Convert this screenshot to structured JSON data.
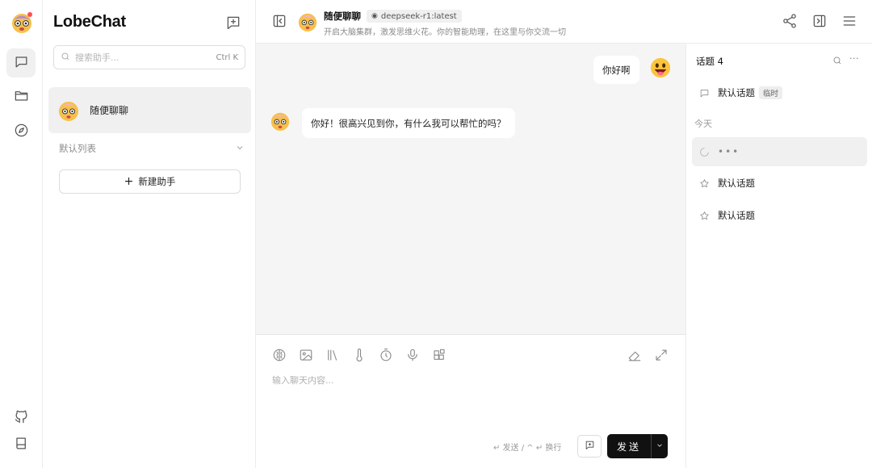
{
  "rail": {
    "items": [
      {
        "name": "chat-icon",
        "active": true
      },
      {
        "name": "folder-icon",
        "active": false
      },
      {
        "name": "compass-icon",
        "active": false
      }
    ],
    "bottom": [
      {
        "name": "github-icon"
      },
      {
        "name": "book-icon"
      }
    ]
  },
  "sessions": {
    "logo": "LobeChat",
    "search_placeholder": "搜索助手...",
    "search_shortcut": "Ctrl K",
    "active_session": "随便聊聊",
    "group_label": "默认列表",
    "new_assistant_label": "新建助手"
  },
  "header": {
    "title": "随便聊聊",
    "model": "deepseek-r1:latest",
    "description": "开启大脑集群，激发思维火花。你的智能助理，在这里与你交流一切"
  },
  "messages": [
    {
      "role": "user",
      "text": "你好啊"
    },
    {
      "role": "assistant",
      "text": "你好！很高兴见到你，有什么我可以帮忙的吗？"
    }
  ],
  "composer": {
    "placeholder": "输入聊天内容...",
    "hint": "↵ 发送 / ^ ↵ 换行",
    "send_label": "发送"
  },
  "topics": {
    "title": "话题 4",
    "default_topic": "默认话题",
    "default_tag": "临时",
    "today_label": "今天",
    "loading_text": "•••",
    "items": [
      "默认话题",
      "默认话题"
    ]
  },
  "colors": {
    "accent": "#111111",
    "chat_background": "#f5f5f5",
    "active_item": "#f0f0f0"
  }
}
